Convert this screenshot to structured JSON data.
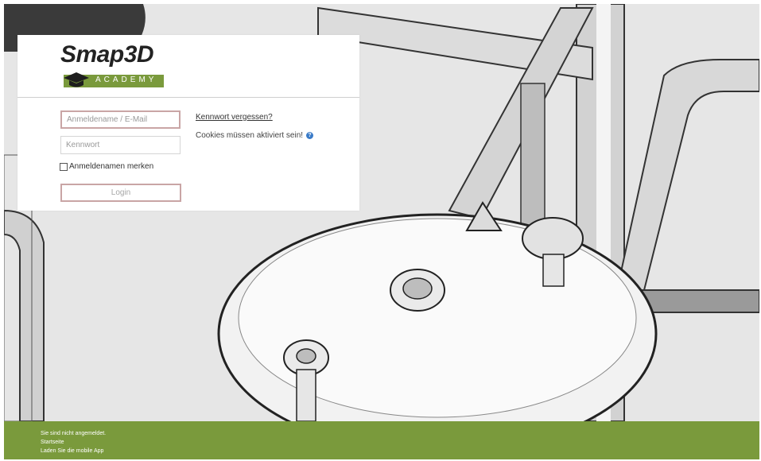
{
  "logo": {
    "brand": "Smap3D",
    "sub": "ACADEMY"
  },
  "login": {
    "username_placeholder": "Anmeldename / E-Mail",
    "password_placeholder": "Kennwort",
    "remember_label": "Anmeldenamen merken",
    "login_button": "Login",
    "forgot_link": "Kennwort vergessen?",
    "cookies_note": "Cookies müssen aktiviert sein!"
  },
  "footer": {
    "not_logged_in": "Sie sind nicht angemeldet.",
    "home_link": "Startseite",
    "mobile_app_link": "Laden Sie die mobile App"
  },
  "colors": {
    "brand_green": "#7a9a3c",
    "field_focus_border": "#c9a5a5",
    "help_icon_blue": "#3a7bc8"
  },
  "icons": {
    "help": "question-circle-icon",
    "logo_hat": "graduation-cap-icon"
  }
}
